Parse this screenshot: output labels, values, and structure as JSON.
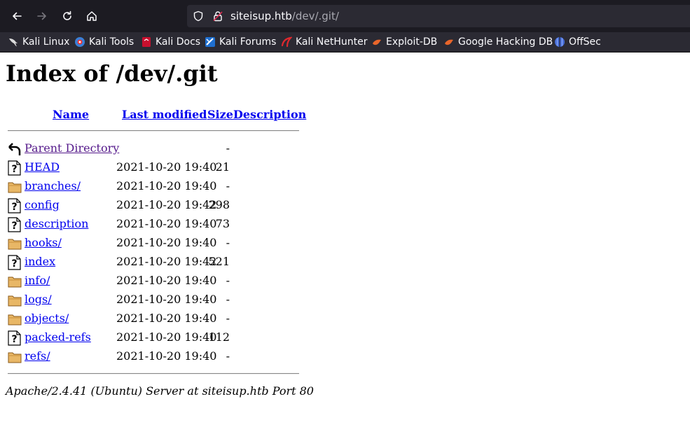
{
  "browser": {
    "url_host": "siteisup.htb",
    "url_path": "/dev/.git/",
    "bookmarks": [
      {
        "label": "Kali Linux",
        "icon": "kali-dragon-icon"
      },
      {
        "label": "Kali Tools",
        "icon": "kali-tools-icon"
      },
      {
        "label": "Kali Docs",
        "icon": "kali-docs-icon"
      },
      {
        "label": "Kali Forums",
        "icon": "kali-forums-icon"
      },
      {
        "label": "Kali NetHunter",
        "icon": "nethunter-icon"
      },
      {
        "label": "Exploit-DB",
        "icon": "exploit-db-icon"
      },
      {
        "label": "Google Hacking DB",
        "icon": "ghdb-icon"
      },
      {
        "label": "OffSec",
        "icon": "offsec-icon"
      }
    ]
  },
  "page": {
    "title": "Index of /dev/.git",
    "headers": {
      "name": "Name",
      "modified": "Last modified",
      "size": "Size",
      "description": "Description"
    },
    "entries": [
      {
        "name": "Parent Directory",
        "modified": "",
        "size": "-",
        "icon": "parent-directory-icon"
      },
      {
        "name": "HEAD",
        "modified": "2021-10-20 19:40",
        "size": "21",
        "icon": "unknown-file-icon"
      },
      {
        "name": "branches/",
        "modified": "2021-10-20 19:40",
        "size": "-",
        "icon": "folder-icon"
      },
      {
        "name": "config",
        "modified": "2021-10-20 19:42",
        "size": "298",
        "icon": "unknown-file-icon"
      },
      {
        "name": "description",
        "modified": "2021-10-20 19:40",
        "size": "73",
        "icon": "unknown-file-icon"
      },
      {
        "name": "hooks/",
        "modified": "2021-10-20 19:40",
        "size": "-",
        "icon": "folder-icon"
      },
      {
        "name": "index",
        "modified": "2021-10-20 19:42",
        "size": "521",
        "icon": "unknown-file-icon"
      },
      {
        "name": "info/",
        "modified": "2021-10-20 19:40",
        "size": "-",
        "icon": "folder-icon"
      },
      {
        "name": "logs/",
        "modified": "2021-10-20 19:40",
        "size": "-",
        "icon": "folder-icon"
      },
      {
        "name": "objects/",
        "modified": "2021-10-20 19:40",
        "size": "-",
        "icon": "folder-icon"
      },
      {
        "name": "packed-refs",
        "modified": "2021-10-20 19:40",
        "size": "112",
        "icon": "unknown-file-icon"
      },
      {
        "name": "refs/",
        "modified": "2021-10-20 19:40",
        "size": "-",
        "icon": "folder-icon"
      }
    ],
    "footer": "Apache/2.4.41 (Ubuntu) Server at siteisup.htb Port 80"
  },
  "colors": {
    "link": "#0000ee",
    "visited": "#551a8b",
    "toolbar_bg": "#1c1b22",
    "urlbar_bg": "#2b2a33"
  }
}
